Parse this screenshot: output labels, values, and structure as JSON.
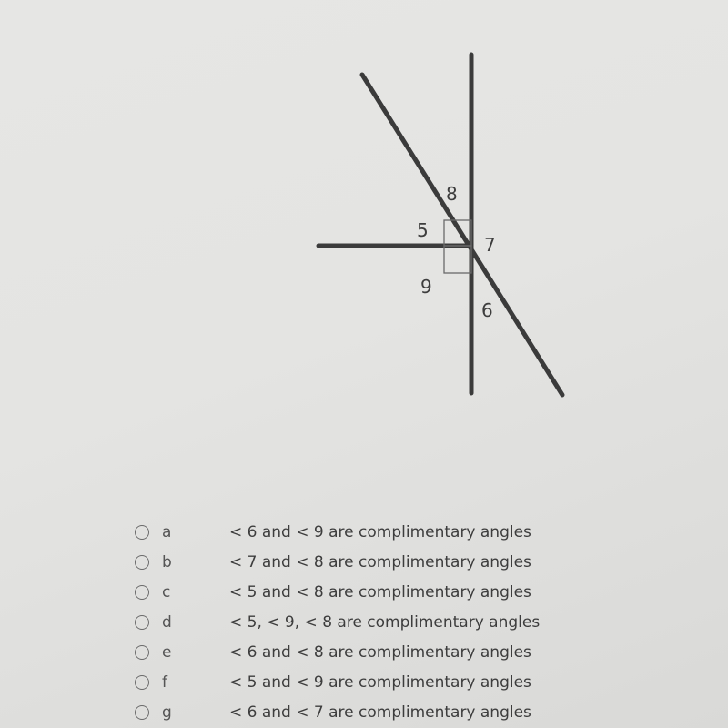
{
  "diagram": {
    "labels": {
      "a5": "5",
      "a6": "6",
      "a7": "7",
      "a8": "8",
      "a9": "9"
    },
    "right_angle_marks": 2
  },
  "question": {
    "options": [
      {
        "letter": "a",
        "text": "< 6 and < 9 are complimentary angles"
      },
      {
        "letter": "b",
        "text": "< 7 and < 8 are complimentary angles"
      },
      {
        "letter": "c",
        "text": "< 5 and < 8 are complimentary angles"
      },
      {
        "letter": "d",
        "text": "< 5, < 9, < 8 are complimentary angles"
      },
      {
        "letter": "e",
        "text": "< 6 and < 8 are complimentary angles"
      },
      {
        "letter": "f",
        "text": "< 5 and < 9 are complimentary angles"
      },
      {
        "letter": "g",
        "text": "< 6 and < 7 are complimentary angles"
      }
    ],
    "selected": null
  }
}
